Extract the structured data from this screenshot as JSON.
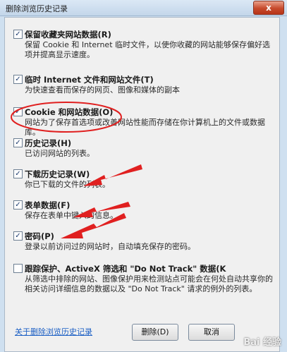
{
  "window": {
    "title": "删除浏览历史记录",
    "close_label": "x"
  },
  "options": [
    {
      "label": "保留收藏夹网站数据(R)",
      "desc": "保留 Cookie 和 Internet 临时文件，以使你收藏的网站能够保存偏好选项并提高显示速度。",
      "checked": true,
      "check": "✓"
    },
    {
      "label": "临时 Internet 文件和网站文件(T)",
      "desc": "为快速查看而保存的网页、图像和媒体的副本",
      "checked": true,
      "check": "✓"
    },
    {
      "label": "Cookie 和网站数据(O)",
      "desc": "网站为了保存首选项或改善网站性能而存储在你计算机上的文件或数据库。",
      "checked": true,
      "check": "✓"
    },
    {
      "label": "历史记录(H)",
      "desc": "已访问网站的列表。",
      "checked": true,
      "check": "✓"
    },
    {
      "label": "下载历史记录(W)",
      "desc": "你已下载的文件的列表。",
      "checked": true,
      "check": "✓"
    },
    {
      "label": "表单数据(F)",
      "desc": "保存在表单中键入的信息。",
      "checked": true,
      "check": "✓"
    },
    {
      "label": "密码(P)",
      "desc": "登录以前访问过的网站时，自动填充保存的密码。",
      "checked": true,
      "check": "✓"
    },
    {
      "label": "跟踪保护、ActiveX 筛选和 \"Do Not Track\" 数据(K",
      "desc": "从筛选中排除的网站、图像保护用来检测站点可能会在何处自动共享你的相关访问详细信息的数据以及 \"Do Not Track\" 请求的例外的列表。",
      "checked": false,
      "check": ""
    }
  ],
  "footer": {
    "link": "关于删除浏览历史记录",
    "delete_button": "删除(D)",
    "cancel_button": "取消"
  },
  "watermark": "Bai 经验",
  "colors": {
    "annotation_red": "#e02020",
    "link_blue": "#1a5ec4"
  }
}
